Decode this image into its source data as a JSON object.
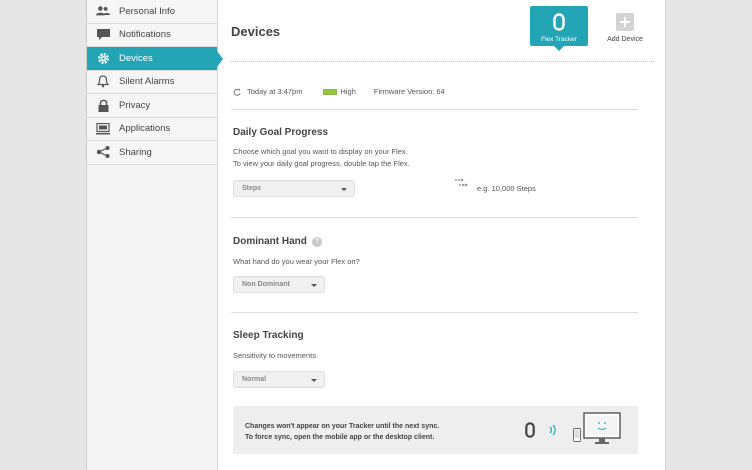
{
  "sidebar": {
    "items": [
      {
        "label": "Personal Info"
      },
      {
        "label": "Notifications"
      },
      {
        "label": "Devices"
      },
      {
        "label": "Silent Alarms"
      },
      {
        "label": "Privacy"
      },
      {
        "label": "Applications"
      },
      {
        "label": "Sharing"
      }
    ]
  },
  "header": {
    "title": "Devices",
    "tracker_label": "Flex Tracker",
    "add_label": "Add Device"
  },
  "status": {
    "sync_time": "Today at 3:47pm",
    "battery": "High",
    "firmware": "Firmware Version: 64"
  },
  "goal": {
    "title": "Daily Goal Progress",
    "desc_line1": "Choose which goal you want to display on your Flex.",
    "desc_line2": "To view your daily goal progress, double tap the Flex.",
    "select_value": "Steps",
    "example": "e.g. 10,000 Steps"
  },
  "hand": {
    "title": "Dominant Hand",
    "desc": "What hand do you wear your Flex on?",
    "select_value": "Non Dominant"
  },
  "sleep": {
    "title": "Sleep Tracking",
    "desc": "Sensitivity to movements",
    "select_value": "Normal"
  },
  "notice": {
    "line1": "Changes won't appear on your Tracker until the next sync.",
    "line2": "To force sync, open the mobile app or the desktop client."
  },
  "colors": {
    "accent": "#23a5b5",
    "battery": "#8ccc3d"
  }
}
